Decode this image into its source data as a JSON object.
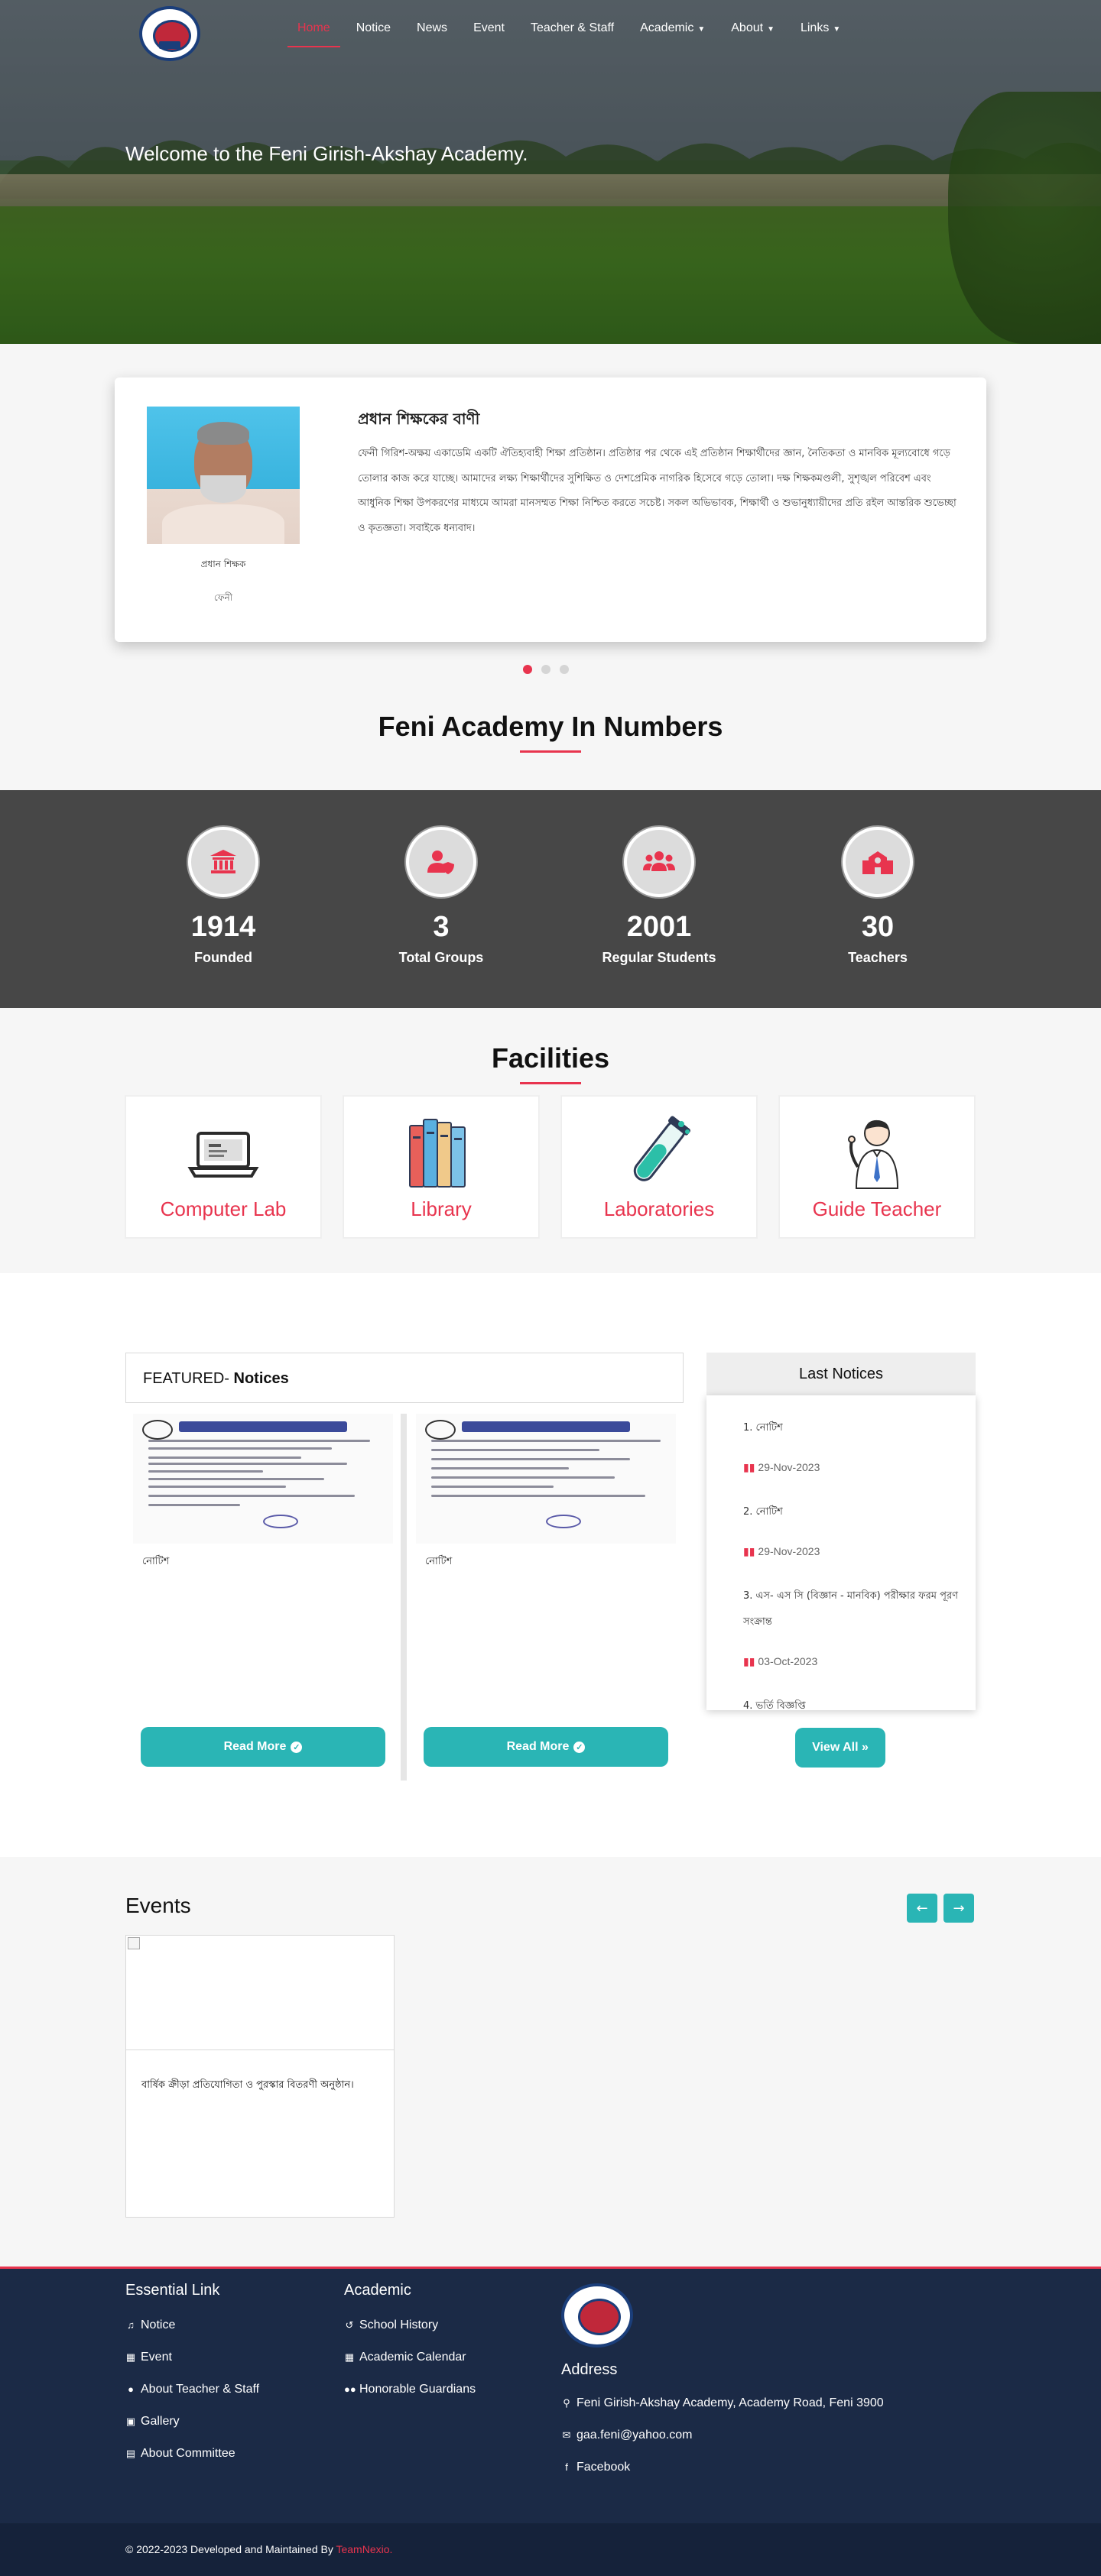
{
  "nav": {
    "items": [
      {
        "label": "Home",
        "active": true
      },
      {
        "label": "Notice"
      },
      {
        "label": "News"
      },
      {
        "label": "Event"
      },
      {
        "label": "Teacher & Staff"
      },
      {
        "label": "Academic",
        "dropdown": true
      },
      {
        "label": "About",
        "dropdown": true
      },
      {
        "label": "Links",
        "dropdown": true
      }
    ]
  },
  "hero": {
    "title": "Welcome to the Feni Girish-Akshay Academy."
  },
  "message": {
    "title": "প্রধান শিক্ষকের বাণী",
    "text": "ফেনী গিরিশ-অক্ষয় একাডেমি একটি ঐতিহ্যবাহী শিক্ষা প্রতিষ্ঠান। প্রতিষ্ঠার পর থেকে এই প্রতিষ্ঠান শিক্ষার্থীদের জ্ঞান, নৈতিকতা ও মানবিক মূল্যবোধে গড়ে তোলার কাজ করে যাচ্ছে। আমাদের লক্ষ্য শিক্ষার্থীদের সুশিক্ষিত ও দেশপ্রেমিক নাগরিক হিসেবে গড়ে তোলা। দক্ষ শিক্ষকমণ্ডলী, সুশৃঙ্খল পরিবেশ এবং আধুনিক শিক্ষা উপকরণের মাধ্যমে আমরা মানসম্মত শিক্ষা নিশ্চিত করতে সচেষ্ট। সকল অভিভাবক, শিক্ষার্থী ও শুভানুধ্যায়ীদের প্রতি রইল আন্তরিক শুভেচ্ছা ও কৃতজ্ঞতা। সবাইকে ধন্যবাদ।",
    "name": "প্রধান শিক্ষক",
    "role": "ফেনী"
  },
  "numbers": {
    "heading": "Feni Academy In Numbers",
    "stats": [
      {
        "value": "1914",
        "label": "Founded",
        "icon": "institution-icon"
      },
      {
        "value": "3",
        "label": "Total Groups",
        "icon": "user-shield-icon"
      },
      {
        "value": "2001",
        "label": "Regular Students",
        "icon": "users-icon"
      },
      {
        "value": "30",
        "label": "Teachers",
        "icon": "school-icon"
      }
    ]
  },
  "facilities": {
    "heading": "Facilities",
    "items": [
      {
        "label": "Computer Lab",
        "icon": "laptop-icon"
      },
      {
        "label": "Library",
        "icon": "books-icon"
      },
      {
        "label": "Laboratories",
        "icon": "test-tube-icon"
      },
      {
        "label": "Guide Teacher",
        "icon": "teacher-icon"
      }
    ]
  },
  "notices": {
    "featured_prefix": "FEATURED- ",
    "featured_label": "Notices",
    "cards": [
      {
        "title": "নোটিশ",
        "button": "Read More"
      },
      {
        "title": "নোটিশ",
        "button": "Read More"
      }
    ],
    "last_heading": "Last Notices",
    "last": [
      {
        "title": "1. নোটিশ",
        "date": "29-Nov-2023"
      },
      {
        "title": "2. নোটিশ",
        "date": "29-Nov-2023"
      },
      {
        "title": "3. এস- এস সি (বিজ্ঞান - মানবিক) পরীক্ষার ফরম পূরণ সংক্রান্ত",
        "date": "03-Oct-2023"
      },
      {
        "title": "4. ভর্তি বিজ্ঞপ্তি",
        "date": ""
      }
    ],
    "view_all": "View All »"
  },
  "events": {
    "heading": "Events",
    "items": [
      {
        "title": "বার্ষিক ক্রীড়া প্রতিযোগিতা ও পুরস্কার বিতরণী অনুষ্ঠান।"
      }
    ]
  },
  "footer": {
    "essential_heading": "Essential Link",
    "essential": [
      "Notice",
      "Event",
      "About Teacher & Staff",
      "Gallery",
      "About Committee"
    ],
    "academic_heading": "Academic",
    "academic": [
      "School History",
      "Academic Calendar",
      "Honorable Guardians"
    ],
    "address_heading": "Address",
    "address": "Feni Girish-Akshay Academy, Academy Road, Feni 3900",
    "email": "gaa.feni@yahoo.com",
    "facebook": "Facebook",
    "copyright": "© 2022-2023 Developed and Maintained By ",
    "brand": "TeamNexio."
  },
  "colors": {
    "accent": "#e8344e",
    "teal": "#2ab5b5",
    "footer": "#1b2a46",
    "stats_band": "#474747"
  }
}
